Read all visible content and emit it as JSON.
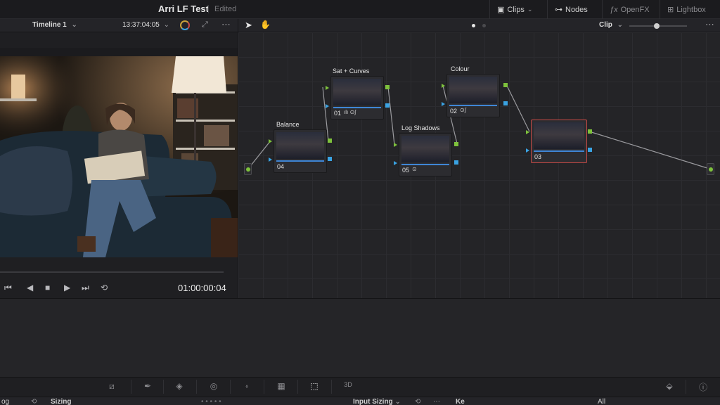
{
  "header": {
    "project_title": "Arri LF Test",
    "project_status": "Edited",
    "clips_label": "Clips",
    "nodes_label": "Nodes",
    "openfx_label": "OpenFX",
    "lightbox_label": "Lightbox"
  },
  "viewer": {
    "timeline_label": "Timeline 1",
    "source_timecode": "13:37:04:05",
    "timecode": "01:00:00:04"
  },
  "node_editor": {
    "mode_label": "Clip",
    "nodes": [
      {
        "number": "01",
        "name": "Sat + Curves"
      },
      {
        "number": "02",
        "name": "Colour"
      },
      {
        "number": "03",
        "name": ""
      },
      {
        "number": "04",
        "name": "Balance"
      },
      {
        "number": "05",
        "name": "Log Shadows"
      }
    ]
  },
  "bottom": {
    "left_label": "og",
    "sizing_label": "Sizing",
    "input_sizing_label": "Input Sizing",
    "key_label": "Ke",
    "all_label": "All"
  },
  "colors": {
    "accent_blue": "#3f86d6",
    "port_green": "#7ec23c",
    "port_blue": "#3aa3e3",
    "selected_border": "#c74a46"
  }
}
